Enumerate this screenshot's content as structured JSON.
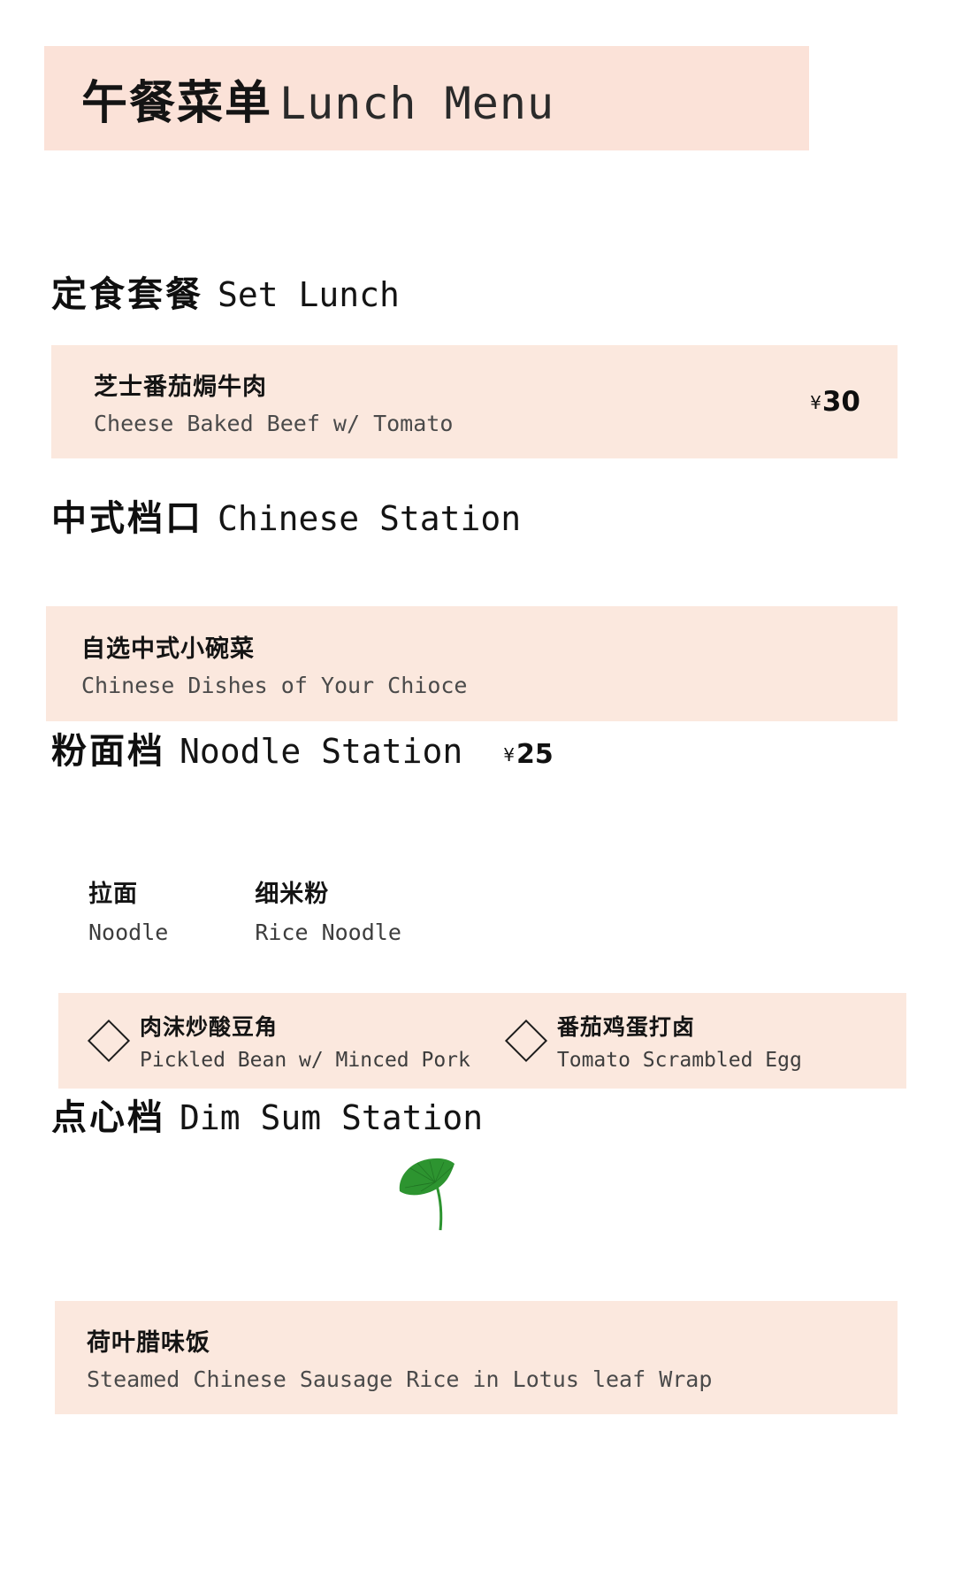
{
  "header": {
    "title_cn": "午餐菜单",
    "title_en": "Lunch Menu",
    "background_color": "#fbe2d8"
  },
  "currency_symbol": "¥",
  "sections": [
    {
      "heading_cn": "定食套餐",
      "heading_en": "Set Lunch",
      "items": [
        {
          "name_cn": "芝士番茄焗牛肉",
          "name_en": "Cheese Baked Beef w/ Tomato",
          "price": "30"
        }
      ]
    },
    {
      "heading_cn": "中式档口",
      "heading_en": "Chinese Station",
      "items": [
        {
          "name_cn": "自选中式小碗菜",
          "name_en": "Chinese Dishes of Your Chioce"
        }
      ]
    },
    {
      "heading_cn": "粉面档",
      "heading_en": "Noodle Station",
      "price": "25",
      "bases": [
        {
          "name_cn": "拉面",
          "name_en": "Noodle"
        },
        {
          "name_cn": "细米粉",
          "name_en": "Rice Noodle"
        }
      ],
      "toppings": [
        {
          "marker": "diamond-icon",
          "name_cn": "肉沫炒酸豆角",
          "name_en": "Pickled Bean w/ Minced Pork"
        },
        {
          "marker": "diamond-icon",
          "name_cn": "番茄鸡蛋打卤",
          "name_en": "Tomato Scrambled Egg"
        }
      ]
    },
    {
      "heading_cn": "点心档",
      "heading_en": "Dim Sum Station",
      "decoration": "lotus-leaf-icon",
      "items": [
        {
          "name_cn": "荷叶腊味饭",
          "name_en": "Steamed Chinese Sausage Rice in Lotus leaf Wrap"
        }
      ]
    }
  ],
  "colors": {
    "card_background": "#fbe8de",
    "banner_background": "#fbe2d8",
    "page_background": "#ffffff",
    "lotus_green": "#2d9430",
    "text_primary": "#141414",
    "text_secondary": "#4a4a4a"
  }
}
